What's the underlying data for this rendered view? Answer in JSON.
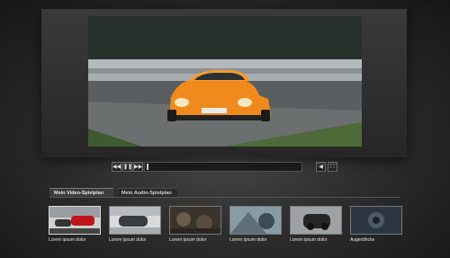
{
  "player": {
    "controls": [
      {
        "name": "skip-back-button",
        "glyph": "◀◀"
      },
      {
        "name": "pause-button",
        "glyph": "❚❚"
      },
      {
        "name": "skip-forward-button",
        "glyph": "▶▶"
      }
    ],
    "volume_glyph": "◀",
    "fullscreen_glyph": "⛶",
    "progress": 0.0
  },
  "tabs": [
    {
      "label": "Mein Video-Spielplan",
      "active": true
    },
    {
      "label": "Mein Audio-Spielplan",
      "active": false
    }
  ],
  "thumbnails": [
    {
      "caption": "Lorem ipsum dolor"
    },
    {
      "caption": "Lorem ipsum dolor"
    },
    {
      "caption": "Lorem ipsum dolor"
    },
    {
      "caption": "Lorem ipsum dolor"
    },
    {
      "caption": "Lorem ipsum dolor"
    },
    {
      "caption": "Augenblicke"
    }
  ],
  "colors": {
    "car": "#f08a1c",
    "background": "#2e2e2e"
  }
}
